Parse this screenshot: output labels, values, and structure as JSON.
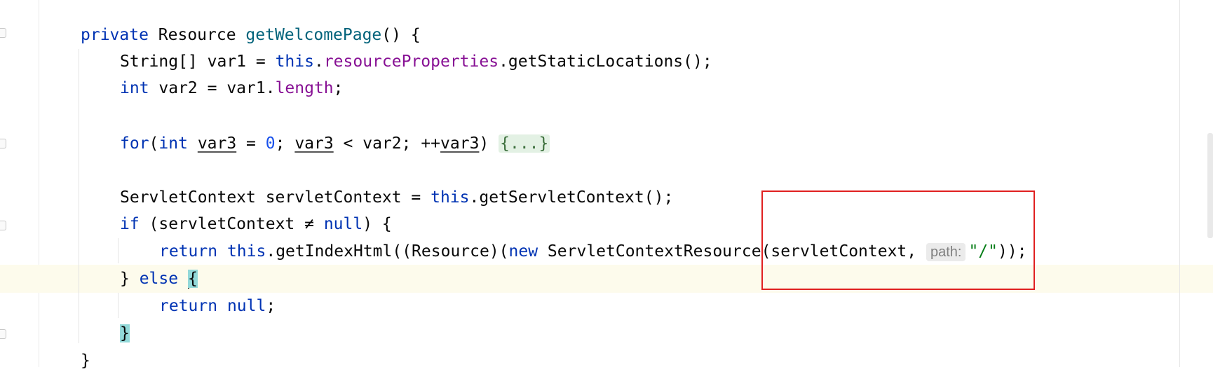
{
  "editor": {
    "lines": {
      "l1": {
        "kw": "private",
        "type": " Resource ",
        "method": "getWelcomePage",
        "rest": "() {"
      },
      "l2": {
        "pre": "String[] var1 = ",
        "this": "this",
        "dot": ".",
        "field": "resourceProperties",
        "rest": ".getStaticLocations();"
      },
      "l3": {
        "kw": "int",
        "mid": " var2 = var1.",
        "field": "length",
        "rest": ";"
      },
      "l4": {
        "kw_for": "for",
        "paren": "(",
        "kw_int": "int",
        "sp": " ",
        "v3a": "var3",
        "eq": " = ",
        "zero": "0",
        "semi": "; ",
        "v3b": "var3",
        "cmp": " < var2; ",
        "inc": "++",
        "v3c": "var3",
        "close": ") ",
        "fold": "{...}"
      },
      "l5": {
        "pre": "ServletContext servletContext = ",
        "this": "this",
        "rest": ".getServletContext();"
      },
      "l6": {
        "kw_if": "if",
        "mid": " (servletContext ",
        "ne": "≠",
        "sp": " ",
        "null": "null",
        "rest": ") {"
      },
      "l7": {
        "ret": "return",
        "sp1": " ",
        "this": "this",
        "mid": ".getIndexHtml((Resource)(",
        "new": "new",
        "rest": " ServletContextResource(servletContext, ",
        "hint": "path:",
        "str": "\"/\"",
        "end": "));"
      },
      "l8": {
        "pre": "} ",
        "else": "else",
        "sp": " ",
        "brace": "{"
      },
      "l9": {
        "ret": "return",
        "sp": " ",
        "null": "null",
        "end": ";"
      },
      "l10": {
        "brace": "}"
      },
      "l11": {
        "brace": "}"
      }
    }
  },
  "annotation": {
    "color": "#e02020"
  }
}
